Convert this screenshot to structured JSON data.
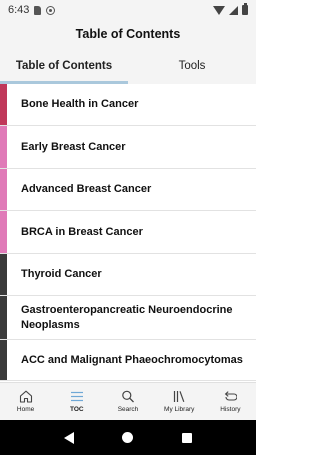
{
  "status_bar": {
    "time": "6:43"
  },
  "header": {
    "title": "Table of Contents"
  },
  "tabs": [
    {
      "label": "Table of Contents",
      "active": true
    },
    {
      "label": "Tools",
      "active": false
    }
  ],
  "toc": {
    "items": [
      {
        "label": "Bone Health in Cancer",
        "color": "#c0385a"
      },
      {
        "label": "Early Breast Cancer",
        "color": "#e07ab8"
      },
      {
        "label": "Advanced Breast Cancer",
        "color": "#e07ab8"
      },
      {
        "label": "BRCA in Breast Cancer",
        "color": "#e07ab8"
      },
      {
        "label": "Thyroid Cancer",
        "color": "#3a3a3a"
      },
      {
        "label": "Gastroenteropancreatic Neuroendocrine Neoplasms",
        "color": "#3a3a3a"
      },
      {
        "label": "ACC and Malignant Phaeochromocytomas",
        "color": "#3a3a3a"
      }
    ]
  },
  "bottom_nav": {
    "items": [
      {
        "label": "Home",
        "icon": "home-icon"
      },
      {
        "label": "TOC",
        "icon": "list-icon",
        "active": true
      },
      {
        "label": "Search",
        "icon": "search-icon"
      },
      {
        "label": "My Library",
        "icon": "library-icon"
      },
      {
        "label": "History",
        "icon": "history-icon"
      }
    ]
  }
}
